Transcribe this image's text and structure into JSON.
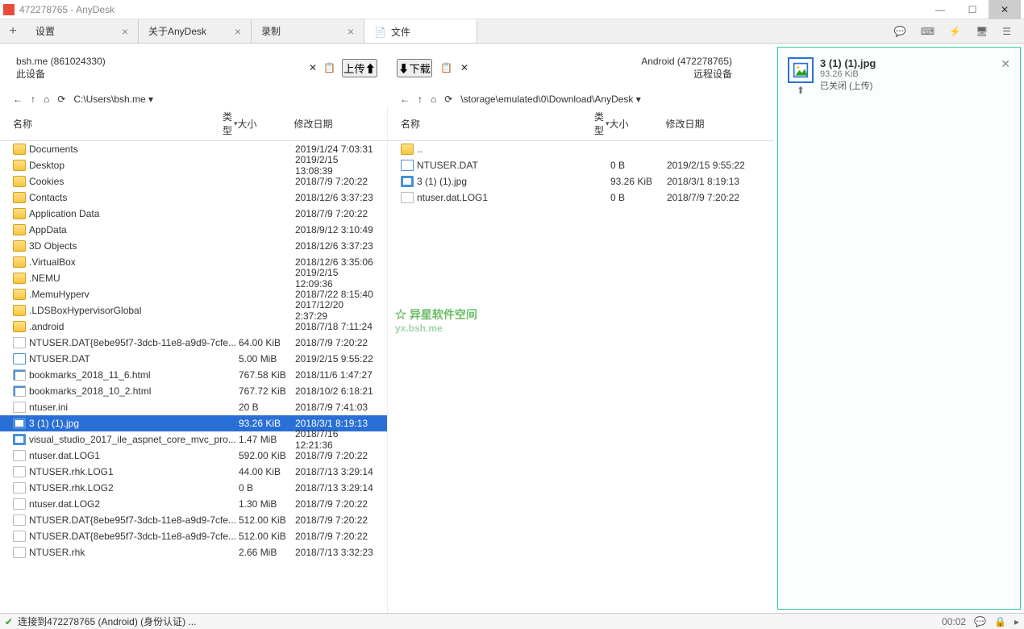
{
  "window": {
    "title": "472278765 - AnyDesk"
  },
  "tabs": {
    "new_label": "+",
    "items": [
      {
        "label": "设置",
        "icon": ""
      },
      {
        "label": "关于AnyDesk",
        "icon": ""
      },
      {
        "label": "录制",
        "icon": ""
      },
      {
        "label": "文件",
        "icon": "📄",
        "active": true
      }
    ]
  },
  "toolbar_icons": [
    "chat-icon",
    "keyboard-icon",
    "lightning-icon",
    "monitor-icon",
    "menu-icon"
  ],
  "local_device": {
    "name": "bsh.me (861024330)",
    "sub": "此设备"
  },
  "remote_device": {
    "name": "Android (472278765)",
    "sub": "远程设备"
  },
  "buttons": {
    "upload": "上传",
    "download": "下载"
  },
  "local_path": "C:\\Users\\bsh.me",
  "remote_path": "\\storage\\emulated\\0\\Download\\AnyDesk",
  "columns": {
    "name": "名称",
    "type": "类型",
    "size": "大小",
    "date": "修改日期"
  },
  "local_files": [
    {
      "icon": "folder",
      "name": "Documents",
      "size": "",
      "date": "2019/1/24 7:03:31"
    },
    {
      "icon": "folder",
      "name": "Desktop",
      "size": "",
      "date": "2019/2/15 13:08:39"
    },
    {
      "icon": "folder",
      "name": "Cookies",
      "size": "",
      "date": "2018/7/9 7:20:22"
    },
    {
      "icon": "folder",
      "name": "Contacts",
      "size": "",
      "date": "2018/12/6 3:37:23"
    },
    {
      "icon": "folder",
      "name": "Application Data",
      "size": "",
      "date": "2018/7/9 7:20:22"
    },
    {
      "icon": "folder",
      "name": "AppData",
      "size": "",
      "date": "2018/9/12 3:10:49"
    },
    {
      "icon": "folder",
      "name": "3D Objects",
      "size": "",
      "date": "2018/12/6 3:37:23"
    },
    {
      "icon": "folder",
      "name": ".VirtualBox",
      "size": "",
      "date": "2018/12/6 3:35:06"
    },
    {
      "icon": "folder",
      "name": ".NEMU",
      "size": "",
      "date": "2019/2/15 12:09:36"
    },
    {
      "icon": "folder",
      "name": ".MemuHyperv",
      "size": "",
      "date": "2018/7/22 8:15:40"
    },
    {
      "icon": "folder",
      "name": ".LDSBoxHypervisorGlobal",
      "size": "",
      "date": "2017/12/20 2:37:29"
    },
    {
      "icon": "folder",
      "name": ".android",
      "size": "",
      "date": "2018/7/18 7:11:24"
    },
    {
      "icon": "file",
      "name": "NTUSER.DAT{8ebe95f7-3dcb-11e8-a9d9-7cfe...",
      "size": "64.00 KiB",
      "date": "2018/7/9 7:20:22"
    },
    {
      "icon": "dat",
      "name": "NTUSER.DAT",
      "size": "5.00 MiB",
      "date": "2019/2/15 9:55:22"
    },
    {
      "icon": "html",
      "name": "bookmarks_2018_11_6.html",
      "size": "767.58 KiB",
      "date": "2018/11/6 1:47:27"
    },
    {
      "icon": "html",
      "name": "bookmarks_2018_10_2.html",
      "size": "767.72 KiB",
      "date": "2018/10/2 6:18:21"
    },
    {
      "icon": "file",
      "name": "ntuser.ini",
      "size": "20 B",
      "date": "2018/7/9 7:41:03"
    },
    {
      "icon": "img",
      "name": "3 (1) (1).jpg",
      "size": "93.26 KiB",
      "date": "2018/3/1 8:19:13",
      "selected": true
    },
    {
      "icon": "img",
      "name": "visual_studio_2017_ile_aspnet_core_mvc_pro...",
      "size": "1.47 MiB",
      "date": "2018/7/16 12:21:36"
    },
    {
      "icon": "file",
      "name": "ntuser.dat.LOG1",
      "size": "592.00 KiB",
      "date": "2018/7/9 7:20:22"
    },
    {
      "icon": "file",
      "name": "NTUSER.rhk.LOG1",
      "size": "44.00 KiB",
      "date": "2018/7/13 3:29:14"
    },
    {
      "icon": "file",
      "name": "NTUSER.rhk.LOG2",
      "size": "0 B",
      "date": "2018/7/13 3:29:14"
    },
    {
      "icon": "file",
      "name": "ntuser.dat.LOG2",
      "size": "1.30 MiB",
      "date": "2018/7/9 7:20:22"
    },
    {
      "icon": "file",
      "name": "NTUSER.DAT{8ebe95f7-3dcb-11e8-a9d9-7cfe...",
      "size": "512.00 KiB",
      "date": "2018/7/9 7:20:22"
    },
    {
      "icon": "file",
      "name": "NTUSER.DAT{8ebe95f7-3dcb-11e8-a9d9-7cfe...",
      "size": "512.00 KiB",
      "date": "2018/7/9 7:20:22"
    },
    {
      "icon": "file",
      "name": "NTUSER.rhk",
      "size": "2.66 MiB",
      "date": "2018/7/13 3:32:23"
    }
  ],
  "remote_files": [
    {
      "icon": "folder",
      "name": "..",
      "size": "",
      "date": ""
    },
    {
      "icon": "dat",
      "name": "NTUSER.DAT",
      "size": "0 B",
      "date": "2019/2/15 9:55:22"
    },
    {
      "icon": "img",
      "name": "3 (1) (1).jpg",
      "size": "93.26 KiB",
      "date": "2018/3/1 8:19:13"
    },
    {
      "icon": "file",
      "name": "ntuser.dat.LOG1",
      "size": "0 B",
      "date": "2018/7/9 7:20:22"
    }
  ],
  "queue": {
    "item": {
      "name": "3 (1) (1).jpg",
      "size": "93.26 KiB",
      "status": "已关闭 (上传)"
    }
  },
  "status": {
    "text": "连接到472278765 (Android)   (身份认证) ...",
    "time": "00:02"
  },
  "watermark": {
    "line1": "异星软件空间",
    "line2": "yx.bsh.me"
  }
}
